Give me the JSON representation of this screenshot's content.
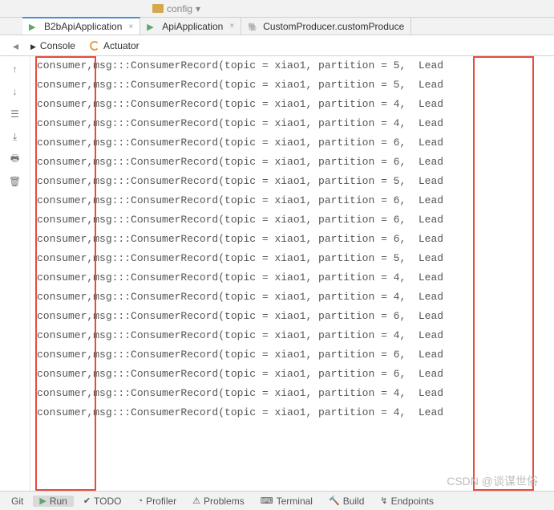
{
  "topbar": {
    "label": "config"
  },
  "tabs": [
    {
      "label": "B2bApiApplication",
      "active": true,
      "iconType": "green"
    },
    {
      "label": "ApiApplication",
      "active": false,
      "iconType": "green"
    },
    {
      "label": "CustomProducer.customProduce",
      "active": false,
      "iconType": "elephant"
    }
  ],
  "subTabs": {
    "console": "Console",
    "actuator": "Actuator"
  },
  "sidebar": {
    "up": "↑",
    "down": "↓",
    "stack": "⇆",
    "wrap": "⇥",
    "print": "🖶",
    "trash": "🗑"
  },
  "consoleLines": [
    "consumer,msg:::ConsumerRecord(topic = xiao1, partition = 5,  Lead",
    "consumer,msg:::ConsumerRecord(topic = xiao1, partition = 5,  Lead",
    "consumer,msg:::ConsumerRecord(topic = xiao1, partition = 4,  Lead",
    "consumer,msg:::ConsumerRecord(topic = xiao1, partition = 4,  Lead",
    "consumer,msg:::ConsumerRecord(topic = xiao1, partition = 6,  Lead",
    "consumer,msg:::ConsumerRecord(topic = xiao1, partition = 6,  Lead",
    "consumer,msg:::ConsumerRecord(topic = xiao1, partition = 5,  Lead",
    "consumer,msg:::ConsumerRecord(topic = xiao1, partition = 6,  Lead",
    "consumer,msg:::ConsumerRecord(topic = xiao1, partition = 6,  Lead",
    "consumer,msg:::ConsumerRecord(topic = xiao1, partition = 6,  Lead",
    "consumer,msg:::ConsumerRecord(topic = xiao1, partition = 5,  Lead",
    "consumer,msg:::ConsumerRecord(topic = xiao1, partition = 4,  Lead",
    "consumer,msg:::ConsumerRecord(topic = xiao1, partition = 4,  Lead",
    "consumer,msg:::ConsumerRecord(topic = xiao1, partition = 6,  Lead",
    "consumer,msg:::ConsumerRecord(topic = xiao1, partition = 4,  Lead",
    "consumer,msg:::ConsumerRecord(topic = xiao1, partition = 6,  Lead",
    "consumer,msg:::ConsumerRecord(topic = xiao1, partition = 6,  Lead",
    "consumer,msg:::ConsumerRecord(topic = xiao1, partition = 4,  Lead",
    "consumer,msg:::ConsumerRecord(topic = xiao1, partition = 4,  Lead"
  ],
  "bottomTabs": {
    "git": "Git",
    "run": "Run",
    "todo": "TODO",
    "profiler": "Profiler",
    "problems": "Problems",
    "terminal": "Terminal",
    "build": "Build",
    "endpoints": "Endpoints"
  },
  "watermark": "CSDN @谈谋世俗"
}
